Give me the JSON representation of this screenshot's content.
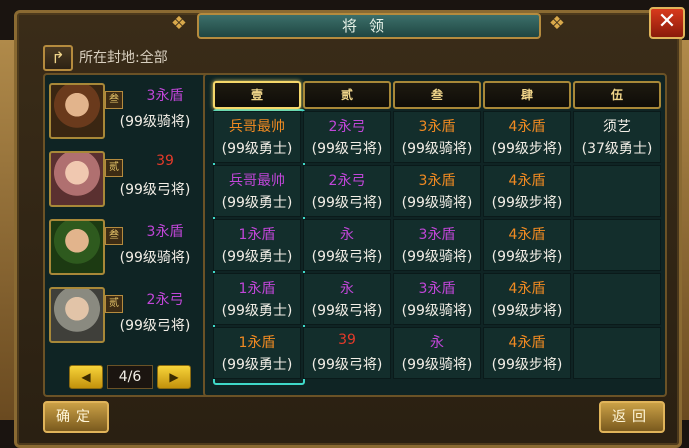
{
  "title": "将领",
  "fief_filter": "所在封地:全部",
  "buttons": {
    "confirm": "确定",
    "back": "返回",
    "close": "✕"
  },
  "colors": {
    "purple": "#c046d8",
    "red": "#e53a2a",
    "orange": "#f08a22",
    "white": "#f2eee6",
    "teal": "#3fd8c8"
  },
  "generals": [
    {
      "badge": "叁",
      "troop": "3永盾",
      "troop_color": "#c046d8",
      "level": "(99级骑将)",
      "portrait": "brown"
    },
    {
      "badge": "贰",
      "troop": "39",
      "troop_color": "#e53a2a",
      "level": "(99级弓将)",
      "portrait": "pink"
    },
    {
      "badge": "叁",
      "troop": "3永盾",
      "troop_color": "#c046d8",
      "level": "(99级骑将)",
      "portrait": "green"
    },
    {
      "badge": "贰",
      "troop": "2永弓",
      "troop_color": "#c046d8",
      "level": "(99级弓将)",
      "portrait": "grey"
    }
  ],
  "pager": {
    "page": "4/6"
  },
  "columns": [
    "壹",
    "贰",
    "叁",
    "肆",
    "伍"
  ],
  "grid": [
    [
      {
        "t1": "兵哥最帅",
        "t1_color": "#f08a22",
        "t2": "(99级勇士)"
      },
      {
        "t1": "2永弓",
        "t1_color": "#c046d8",
        "t2": "(99级弓将)"
      },
      {
        "t1": "3永盾",
        "t1_color": "#f08a22",
        "t2": "(99级骑将)"
      },
      {
        "t1": "4永盾",
        "t1_color": "#f08a22",
        "t2": "(99级步将)"
      },
      {
        "t1": "须艺",
        "t1_color": "#f2eee6",
        "t2": "(37级勇士)"
      }
    ],
    [
      {
        "t1": "兵哥最帅",
        "t1_color": "#c046d8",
        "t2": "(99级勇士)"
      },
      {
        "t1": "2永弓",
        "t1_color": "#c046d8",
        "t2": "(99级弓将)"
      },
      {
        "t1": "3永盾",
        "t1_color": "#f08a22",
        "t2": "(99级骑将)"
      },
      {
        "t1": "4永盾",
        "t1_color": "#f08a22",
        "t2": "(99级步将)"
      },
      {
        "t1": "",
        "t1_color": "#f2eee6",
        "t2": ""
      }
    ],
    [
      {
        "t1": "1永盾",
        "t1_color": "#c046d8",
        "t2": "(99级勇士)"
      },
      {
        "t1": "永",
        "t1_color": "#c046d8",
        "t2": "(99级弓将)"
      },
      {
        "t1": "3永盾",
        "t1_color": "#c046d8",
        "t2": "(99级骑将)"
      },
      {
        "t1": "4永盾",
        "t1_color": "#f08a22",
        "t2": "(99级步将)"
      },
      {
        "t1": "",
        "t1_color": "#f2eee6",
        "t2": ""
      }
    ],
    [
      {
        "t1": "1永盾",
        "t1_color": "#c046d8",
        "t2": "(99级勇士)"
      },
      {
        "t1": "永",
        "t1_color": "#c046d8",
        "t2": "(99级弓将)"
      },
      {
        "t1": "3永盾",
        "t1_color": "#c046d8",
        "t2": "(99级骑将)"
      },
      {
        "t1": "4永盾",
        "t1_color": "#f08a22",
        "t2": "(99级步将)"
      },
      {
        "t1": "",
        "t1_color": "#f2eee6",
        "t2": ""
      }
    ],
    [
      {
        "t1": "1永盾",
        "t1_color": "#f08a22",
        "t2": "(99级勇士)"
      },
      {
        "t1": "39",
        "t1_color": "#e53a2a",
        "t2": "(99级弓将)"
      },
      {
        "t1": "永",
        "t1_color": "#c046d8",
        "t2": "(99级骑将)"
      },
      {
        "t1": "4永盾",
        "t1_color": "#f08a22",
        "t2": "(99级步将)"
      },
      {
        "t1": "",
        "t1_color": "#f2eee6",
        "t2": ""
      }
    ]
  ]
}
